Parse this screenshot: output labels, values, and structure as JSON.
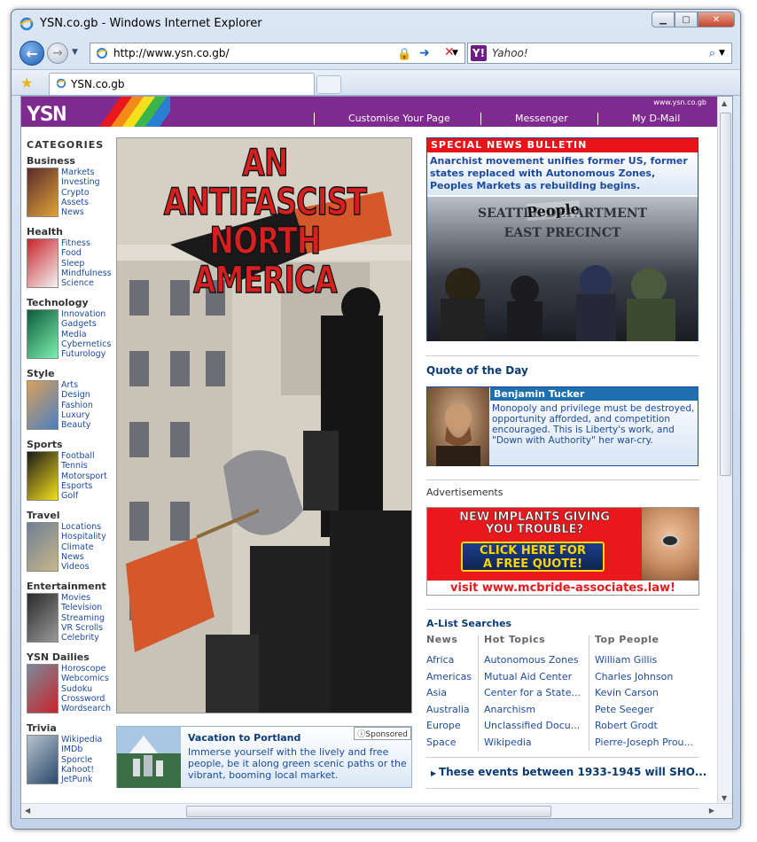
{
  "window": {
    "title": "YSN.co.gb - Windows Internet Explorer"
  },
  "nav": {
    "url": "http://www.ysn.co.gb/",
    "search_placeholder": "Yahoo!"
  },
  "tab": {
    "label": "YSN.co.gb"
  },
  "header": {
    "site_url": "www.ysn.co.gb",
    "logo": "YSN",
    "links": [
      "Customise Your Page",
      "Messenger",
      "My D-Mail"
    ]
  },
  "categories": {
    "title": "CATEGORIES",
    "groups": [
      {
        "name": "Business",
        "items": [
          "Markets",
          "Investing",
          "Crypto",
          "Assets",
          "News"
        ]
      },
      {
        "name": "Health",
        "items": [
          "Fitness",
          "Food",
          "Sleep",
          "Mindfulness",
          "Science"
        ]
      },
      {
        "name": "Technology",
        "items": [
          "Innovation",
          "Gadgets",
          "Media",
          "Cybernetics",
          "Futurology"
        ]
      },
      {
        "name": "Style",
        "items": [
          "Arts",
          "Design",
          "Fashion",
          "Luxury",
          "Beauty"
        ]
      },
      {
        "name": "Sports",
        "items": [
          "Football",
          "Tennis",
          "Motorsport",
          "Esports",
          "Golf"
        ]
      },
      {
        "name": "Travel",
        "items": [
          "Locations",
          "Hospitality",
          "Climate",
          "News",
          "Videos"
        ]
      },
      {
        "name": "Entertainment",
        "items": [
          "Movies",
          "Television",
          "Streaming",
          "VR Scrolls",
          "Celebrity"
        ]
      },
      {
        "name": "YSN Dailies",
        "items": [
          "Horoscope",
          "Webcomics",
          "Sudoku",
          "Crossword",
          "Wordsearch"
        ]
      },
      {
        "name": "Trivia",
        "items": [
          "Wikipedia",
          "IMDb",
          "Sporcle",
          "Kahoot!",
          "JetPunk"
        ]
      }
    ]
  },
  "hero": {
    "headline_line1": "AN ANTIFASCIST",
    "headline_line2": "NORTH AMERICA"
  },
  "sponsored": {
    "badge": "Sponsored",
    "title": "Vacation to Portland",
    "text": "Immerse yourself with the lively and free people, be it along green scenic paths or the vibrant, booming local market."
  },
  "bulletin": {
    "heading": "SPECIAL NEWS BULLETIN",
    "text": "Anarchist movement unifies former US, former states replaced with Autonomous Zones, Peoples Markets as rebuilding begins.",
    "sign_line1": "SEATTLE DEPARTMENT",
    "sign_line2": "EAST PRECINCT",
    "graffiti": "People"
  },
  "quote": {
    "heading": "Quote of the Day",
    "name": "Benjamin Tucker",
    "text": "Monopoly and privilege must be destroyed, opportunity afforded, and competition encouraged. This is Liberty's work, and \"Down with Authority\" her war-cry."
  },
  "ads": {
    "label": "Advertisements",
    "line1": "NEW IMPLANTS GIVING",
    "line2": "YOU TROUBLE?",
    "button1": "CLICK HERE FOR",
    "button2": "A FREE QUOTE!",
    "url": "visit www.mcbride-associates.law!"
  },
  "alist": {
    "heading": "A-List Searches",
    "columns": [
      {
        "title": "News",
        "items": [
          "Africa",
          "Americas",
          "Asia",
          "Australia",
          "Europe",
          "Space"
        ]
      },
      {
        "title": "Hot Topics",
        "items": [
          "Autonomous Zones",
          "Mutual Aid Center",
          "Center for a State...",
          "Anarchism",
          "Unclassified Docu...",
          "Wikipedia"
        ]
      },
      {
        "title": "Top People",
        "items": [
          "William Gillis",
          "Charles Johnson",
          "Kevin Carson",
          "Pete Seeger",
          "Robert Grodt",
          "Pierre-Joseph Prou..."
        ]
      }
    ]
  },
  "events": {
    "text": "These events between 1933-1945 will SHO..."
  }
}
